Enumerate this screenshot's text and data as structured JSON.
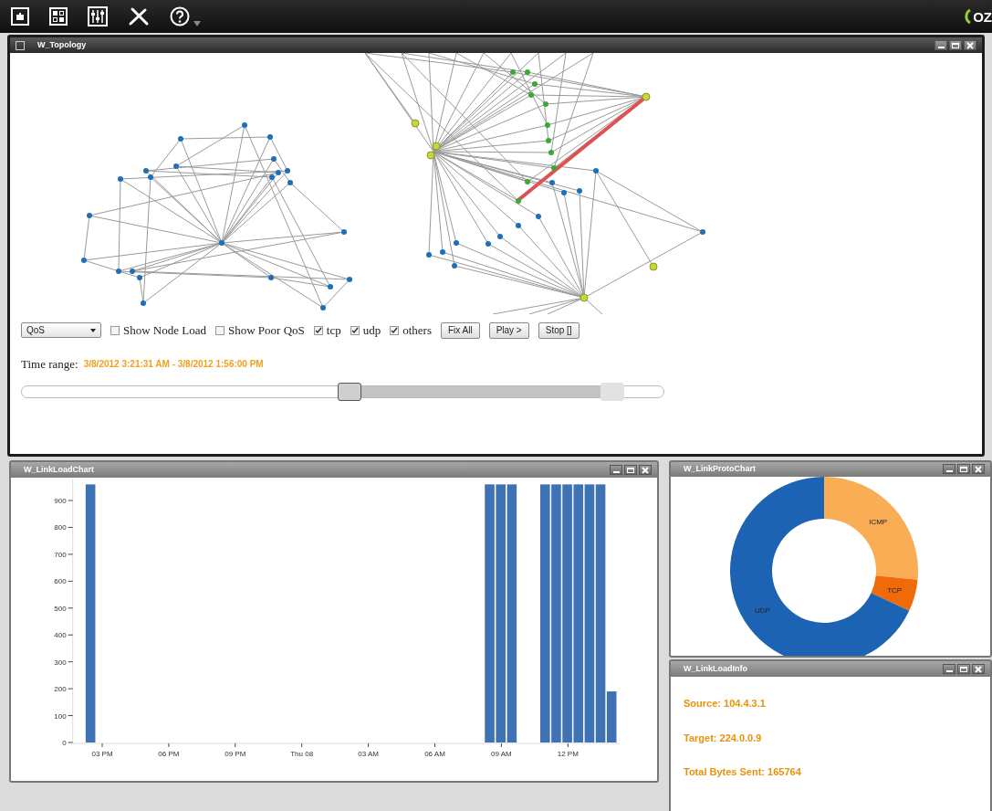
{
  "toolbar": {
    "logo_text": "OZ"
  },
  "topology": {
    "title": "W_Topology",
    "filter_select": {
      "value": "QoS"
    },
    "options": [
      {
        "label": "Show Node Load",
        "checked": false
      },
      {
        "label": "Show Poor QoS",
        "checked": false
      },
      {
        "label": "tcp",
        "checked": true
      },
      {
        "label": "udp",
        "checked": true
      },
      {
        "label": "others",
        "checked": true
      }
    ],
    "buttons": [
      "Fix All",
      "Play >",
      "Stop []"
    ],
    "time_range": {
      "label": "Time range:",
      "value": "3/8/2012 3:21:31 AM - 3/8/2012 1:56:00 PM"
    },
    "time_slider": {
      "thumbs": [
        {
          "level": 0.51
        },
        {
          "level": 0.92
        }
      ]
    }
  },
  "link_load_chart": {
    "title": "W_LinkLoadChart",
    "chart_data": {
      "type": "bar",
      "ylim": [
        0,
        980
      ],
      "categories": [
        null,
        null,
        "03 PM",
        null,
        null,
        null,
        null,
        null,
        "06 PM",
        null,
        null,
        null,
        null,
        null,
        "09 PM",
        null,
        null,
        null,
        null,
        null,
        "Thu 08",
        null,
        null,
        null,
        null,
        null,
        "03 AM",
        null,
        null,
        null,
        null,
        null,
        "06 AM",
        null,
        null,
        null,
        null,
        null,
        "09 AM",
        null,
        null,
        null,
        null,
        null,
        "12 PM",
        null,
        null,
        null,
        null
      ],
      "series": [
        {
          "color": "#3e72b4",
          "values": [
            null,
            960,
            null,
            null,
            null,
            null,
            null,
            null,
            null,
            null,
            null,
            null,
            null,
            null,
            null,
            null,
            null,
            null,
            null,
            null,
            null,
            null,
            null,
            null,
            null,
            null,
            null,
            null,
            null,
            null,
            null,
            null,
            null,
            null,
            null,
            null,
            null,
            960,
            960,
            960,
            null,
            null,
            960,
            960,
            960,
            960,
            960,
            960,
            190
          ]
        }
      ],
      "yticks": [
        0,
        100,
        200,
        300,
        400,
        500,
        600,
        700,
        800,
        900
      ]
    }
  },
  "link_proto_chart": {
    "title": "W_LinkProtoChart",
    "chart_data": {
      "type": "donut",
      "categories": [
        "ICMP",
        "TCP",
        "UDP"
      ],
      "colors": [
        "#f9ad55",
        "#f06a0a",
        "#1d63b4"
      ],
      "values": [
        26.5,
        5.5,
        68
      ]
    }
  },
  "link_load_info": {
    "title": "W_LinkLoadInfo",
    "lines": [
      "Source: 104.4.3.1",
      "Target: 224.0.0.9",
      "Total Bytes Sent: 165764"
    ]
  }
}
